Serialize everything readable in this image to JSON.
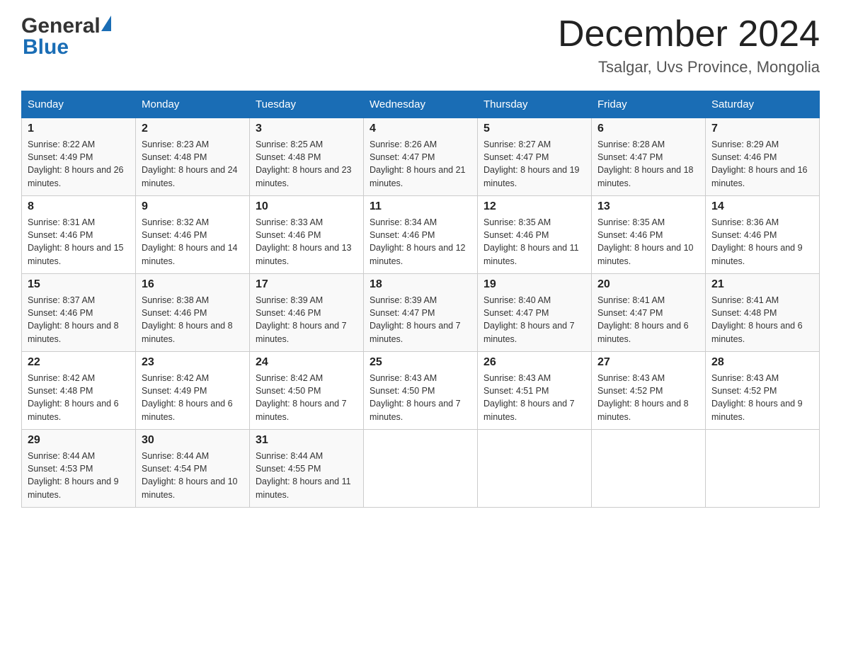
{
  "header": {
    "logo_general": "General",
    "logo_blue": "Blue",
    "title": "December 2024",
    "location": "Tsalgar, Uvs Province, Mongolia"
  },
  "calendar": {
    "days_of_week": [
      "Sunday",
      "Monday",
      "Tuesday",
      "Wednesday",
      "Thursday",
      "Friday",
      "Saturday"
    ],
    "weeks": [
      [
        {
          "day": "1",
          "sunrise": "8:22 AM",
          "sunset": "4:49 PM",
          "daylight": "8 hours and 26 minutes."
        },
        {
          "day": "2",
          "sunrise": "8:23 AM",
          "sunset": "4:48 PM",
          "daylight": "8 hours and 24 minutes."
        },
        {
          "day": "3",
          "sunrise": "8:25 AM",
          "sunset": "4:48 PM",
          "daylight": "8 hours and 23 minutes."
        },
        {
          "day": "4",
          "sunrise": "8:26 AM",
          "sunset": "4:47 PM",
          "daylight": "8 hours and 21 minutes."
        },
        {
          "day": "5",
          "sunrise": "8:27 AM",
          "sunset": "4:47 PM",
          "daylight": "8 hours and 19 minutes."
        },
        {
          "day": "6",
          "sunrise": "8:28 AM",
          "sunset": "4:47 PM",
          "daylight": "8 hours and 18 minutes."
        },
        {
          "day": "7",
          "sunrise": "8:29 AM",
          "sunset": "4:46 PM",
          "daylight": "8 hours and 16 minutes."
        }
      ],
      [
        {
          "day": "8",
          "sunrise": "8:31 AM",
          "sunset": "4:46 PM",
          "daylight": "8 hours and 15 minutes."
        },
        {
          "day": "9",
          "sunrise": "8:32 AM",
          "sunset": "4:46 PM",
          "daylight": "8 hours and 14 minutes."
        },
        {
          "day": "10",
          "sunrise": "8:33 AM",
          "sunset": "4:46 PM",
          "daylight": "8 hours and 13 minutes."
        },
        {
          "day": "11",
          "sunrise": "8:34 AM",
          "sunset": "4:46 PM",
          "daylight": "8 hours and 12 minutes."
        },
        {
          "day": "12",
          "sunrise": "8:35 AM",
          "sunset": "4:46 PM",
          "daylight": "8 hours and 11 minutes."
        },
        {
          "day": "13",
          "sunrise": "8:35 AM",
          "sunset": "4:46 PM",
          "daylight": "8 hours and 10 minutes."
        },
        {
          "day": "14",
          "sunrise": "8:36 AM",
          "sunset": "4:46 PM",
          "daylight": "8 hours and 9 minutes."
        }
      ],
      [
        {
          "day": "15",
          "sunrise": "8:37 AM",
          "sunset": "4:46 PM",
          "daylight": "8 hours and 8 minutes."
        },
        {
          "day": "16",
          "sunrise": "8:38 AM",
          "sunset": "4:46 PM",
          "daylight": "8 hours and 8 minutes."
        },
        {
          "day": "17",
          "sunrise": "8:39 AM",
          "sunset": "4:46 PM",
          "daylight": "8 hours and 7 minutes."
        },
        {
          "day": "18",
          "sunrise": "8:39 AM",
          "sunset": "4:47 PM",
          "daylight": "8 hours and 7 minutes."
        },
        {
          "day": "19",
          "sunrise": "8:40 AM",
          "sunset": "4:47 PM",
          "daylight": "8 hours and 7 minutes."
        },
        {
          "day": "20",
          "sunrise": "8:41 AM",
          "sunset": "4:47 PM",
          "daylight": "8 hours and 6 minutes."
        },
        {
          "day": "21",
          "sunrise": "8:41 AM",
          "sunset": "4:48 PM",
          "daylight": "8 hours and 6 minutes."
        }
      ],
      [
        {
          "day": "22",
          "sunrise": "8:42 AM",
          "sunset": "4:48 PM",
          "daylight": "8 hours and 6 minutes."
        },
        {
          "day": "23",
          "sunrise": "8:42 AM",
          "sunset": "4:49 PM",
          "daylight": "8 hours and 6 minutes."
        },
        {
          "day": "24",
          "sunrise": "8:42 AM",
          "sunset": "4:50 PM",
          "daylight": "8 hours and 7 minutes."
        },
        {
          "day": "25",
          "sunrise": "8:43 AM",
          "sunset": "4:50 PM",
          "daylight": "8 hours and 7 minutes."
        },
        {
          "day": "26",
          "sunrise": "8:43 AM",
          "sunset": "4:51 PM",
          "daylight": "8 hours and 7 minutes."
        },
        {
          "day": "27",
          "sunrise": "8:43 AM",
          "sunset": "4:52 PM",
          "daylight": "8 hours and 8 minutes."
        },
        {
          "day": "28",
          "sunrise": "8:43 AM",
          "sunset": "4:52 PM",
          "daylight": "8 hours and 9 minutes."
        }
      ],
      [
        {
          "day": "29",
          "sunrise": "8:44 AM",
          "sunset": "4:53 PM",
          "daylight": "8 hours and 9 minutes."
        },
        {
          "day": "30",
          "sunrise": "8:44 AM",
          "sunset": "4:54 PM",
          "daylight": "8 hours and 10 minutes."
        },
        {
          "day": "31",
          "sunrise": "8:44 AM",
          "sunset": "4:55 PM",
          "daylight": "8 hours and 11 minutes."
        },
        null,
        null,
        null,
        null
      ]
    ]
  }
}
